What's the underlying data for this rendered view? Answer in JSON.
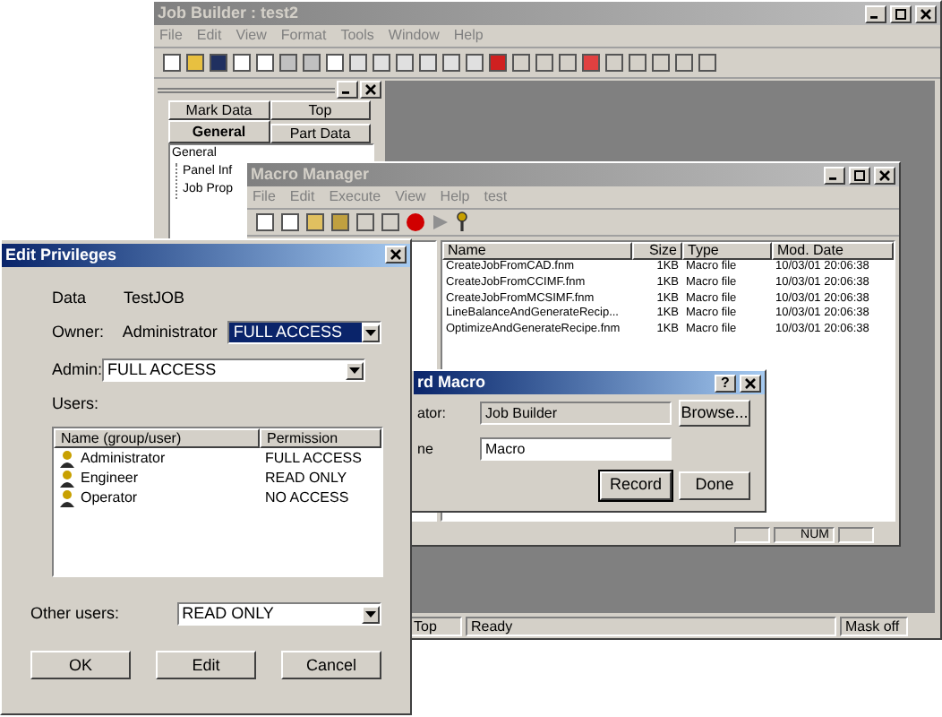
{
  "job_builder": {
    "title": "Job Builder : test2",
    "active": false,
    "menu": [
      "File",
      "Edit",
      "View",
      "Format",
      "Tools",
      "Window",
      "Help"
    ],
    "panel": {
      "tabs": [
        {
          "label": "Mark Data",
          "selected": false
        },
        {
          "label": "Top",
          "selected": false
        },
        {
          "label": "General",
          "selected": true
        },
        {
          "label": "Part Data",
          "selected": false
        }
      ],
      "tree": [
        {
          "label": "General",
          "children": [
            {
              "label": "Panel Inf"
            },
            {
              "label": "Job Prop"
            }
          ]
        }
      ]
    },
    "status_bar": [
      "Top",
      "Ready",
      "Mask off"
    ]
  },
  "macro_manager": {
    "title": "Macro Manager",
    "active": false,
    "menu": [
      "File",
      "Edit",
      "Execute",
      "View",
      "Help",
      "test"
    ],
    "columns": [
      "Name",
      "Size",
      "Type",
      "Mod. Date"
    ],
    "rows": [
      [
        "CreateJobFromCAD.fnm",
        "1KB",
        "Macro file",
        "10/03/01 20:06:38"
      ],
      [
        "CreateJobFromCCIMF.fnm",
        "1KB",
        "Macro file",
        "10/03/01 20:06:38"
      ],
      [
        "CreateJobFromMCSIMF.fnm",
        "1KB",
        "Macro file",
        "10/03/01 20:06:38"
      ],
      [
        "LineBalanceAndGenerateRecip...",
        "1KB",
        "Macro file",
        "10/03/01 20:06:38"
      ],
      [
        "OptimizeAndGenerateRecipe.fnm",
        "1KB",
        "Macro file",
        "10/03/01 20:06:38"
      ]
    ],
    "status_bar": [
      "NUM"
    ]
  },
  "record_macro": {
    "title": "rd Macro",
    "active": true,
    "help_button": "?",
    "fields": [
      {
        "label": "ator:",
        "value": "Job Builder",
        "readonly": true
      },
      {
        "label": "ne",
        "value": "Macro",
        "readonly": false
      }
    ],
    "browse_button": "Browse...",
    "buttons": [
      "Record",
      "Done"
    ]
  },
  "edit_privileges": {
    "title": "Edit Privileges",
    "active": true,
    "data_label": "Data",
    "data_value": "TestJOB",
    "owner_label": "Owner:",
    "owner_value": "Administrator",
    "owner_access": {
      "value": "FULL ACCESS",
      "highlighted": true
    },
    "admin_label": "Admin:",
    "admin_access": {
      "value": "FULL ACCESS",
      "highlighted": false
    },
    "users_label": "Users:",
    "columns": [
      "Name (group/user)",
      "Permission"
    ],
    "users": [
      {
        "name": "Administrator",
        "permission": "FULL ACCESS"
      },
      {
        "name": "Engineer",
        "permission": "READ ONLY"
      },
      {
        "name": "Operator",
        "permission": "NO ACCESS"
      }
    ],
    "other_label": "Other users:",
    "other_access": {
      "value": "READ ONLY",
      "highlighted": false
    },
    "buttons": [
      "OK",
      "Edit",
      "Cancel"
    ]
  }
}
